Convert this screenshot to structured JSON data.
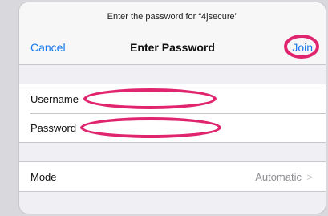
{
  "dialog": {
    "prompt": "Enter the password for “4jsecure”",
    "title": "Enter Password",
    "cancel_label": "Cancel",
    "join_label": "Join"
  },
  "credentials": {
    "username_label": "Username",
    "username_value": "",
    "password_label": "Password",
    "password_value": ""
  },
  "mode": {
    "label": "Mode",
    "value": "Automatic",
    "chevron": ">"
  },
  "colors": {
    "accent": "#1878f0",
    "highlight": "#e0246e",
    "background": "#efeff4"
  },
  "icons": {
    "chevron": "chevron-right-icon"
  }
}
